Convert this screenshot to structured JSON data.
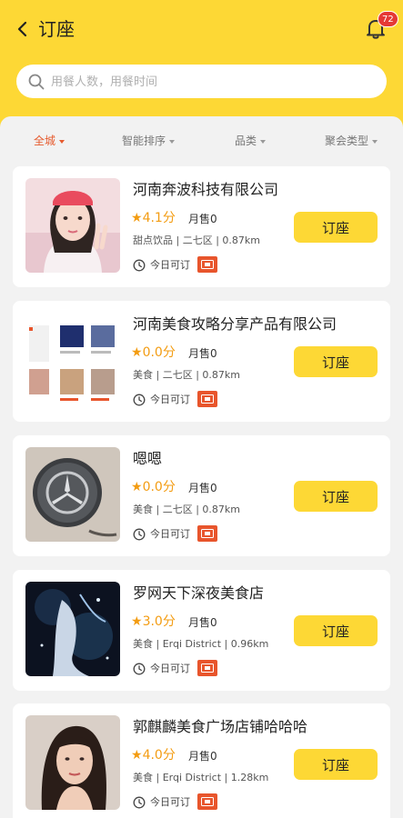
{
  "header": {
    "back_icon": "back-arrow-icon",
    "title": "订座",
    "bell_icon": "bell-icon",
    "notification_count": "72"
  },
  "search": {
    "icon": "search-icon",
    "placeholder": "用餐人数，用餐时间"
  },
  "filters": [
    {
      "label": "全城",
      "active": true
    },
    {
      "label": "智能排序",
      "active": false
    },
    {
      "label": "品类",
      "active": false
    },
    {
      "label": "聚会类型",
      "active": false
    }
  ],
  "colors": {
    "brand_yellow": "#fdd835",
    "accent_orange": "#e65a2d",
    "rating_orange": "#f39c12",
    "tag_red": "#e8552c",
    "badge_red": "#e53935"
  },
  "restaurants": [
    {
      "name": "河南奔波科技有限公司",
      "rating": "4.1分",
      "sales": "月售0",
      "meta": "甜点饮品 | 二七区 | 0.87km",
      "availability": "今日可订",
      "tag_icon": "ticket-icon",
      "button": "订座",
      "thumb": "girl-photo"
    },
    {
      "name": "河南美食攻略分享产品有限公司",
      "rating": "0.0分",
      "sales": "月售0",
      "meta": "美食 | 二七区 | 0.87km",
      "availability": "今日可订",
      "tag_icon": "ticket-icon",
      "button": "订座",
      "thumb": "product-screenshot"
    },
    {
      "name": "嗯嗯",
      "rating": "0.0分",
      "sales": "月售0",
      "meta": "美食 | 二七区 | 0.87km",
      "availability": "今日可订",
      "tag_icon": "ticket-icon",
      "button": "订座",
      "thumb": "car-emblem-photo"
    },
    {
      "name": "罗网天下深夜美食店",
      "rating": "3.0分",
      "sales": "月售0",
      "meta": "美食 | Erqi District | 0.96km",
      "availability": "今日可订",
      "tag_icon": "ticket-icon",
      "button": "订座",
      "thumb": "anime-art"
    },
    {
      "name": "郭麒麟美食广场店铺哈哈哈",
      "rating": "4.0分",
      "sales": "月售0",
      "meta": "美食 | Erqi District | 1.28km",
      "availability": "今日可订",
      "tag_icon": "ticket-icon",
      "button": "订座",
      "thumb": "woman-portrait"
    }
  ]
}
